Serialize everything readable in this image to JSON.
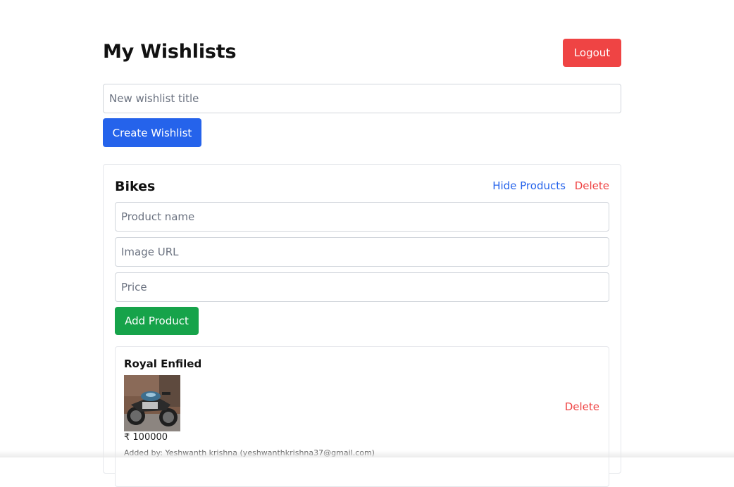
{
  "page": {
    "title": "My Wishlists",
    "logout_label": "Logout",
    "new_wishlist_placeholder": "New wishlist title",
    "create_label": "Create Wishlist"
  },
  "wishlist": {
    "title": "Bikes",
    "toggle_label": "Hide Products",
    "delete_label": "Delete",
    "product_name_placeholder": "Product name",
    "image_url_placeholder": "Image URL",
    "price_placeholder": "Price",
    "add_label": "Add Product",
    "products": [
      {
        "name": "Royal Enfiled",
        "image_alt": "motorcycle-photo",
        "price": "₹ 100000",
        "added_by": "Added by: Yeshwanth krishna (yeshwanthkrishna37@gmail.com)",
        "delete_label": "Delete"
      }
    ]
  },
  "colors": {
    "primary": "#2563eb",
    "danger": "#ef4444",
    "success": "#16a34a"
  }
}
